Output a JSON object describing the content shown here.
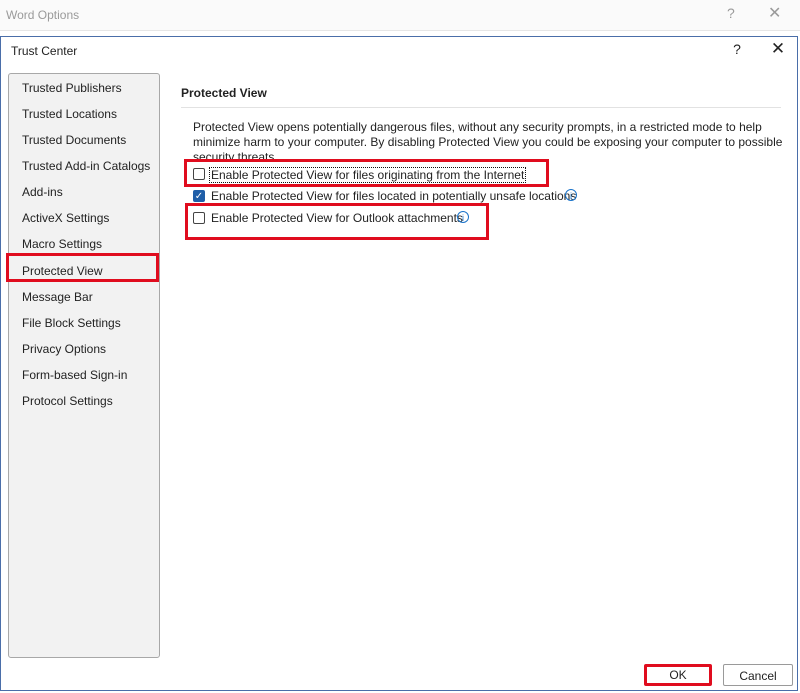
{
  "outer_window": {
    "title": "Word Options",
    "help": "?",
    "close": "✕"
  },
  "dialog": {
    "title": "Trust Center",
    "help": "?",
    "close": "✕"
  },
  "sidebar": {
    "items": [
      {
        "label": "Trusted Publishers"
      },
      {
        "label": "Trusted Locations"
      },
      {
        "label": "Trusted Documents"
      },
      {
        "label": "Trusted Add-in Catalogs"
      },
      {
        "label": "Add-ins"
      },
      {
        "label": "ActiveX Settings"
      },
      {
        "label": "Macro Settings"
      },
      {
        "label": "Protected View",
        "selected": true
      },
      {
        "label": "Message Bar"
      },
      {
        "label": "File Block Settings"
      },
      {
        "label": "Privacy Options"
      },
      {
        "label": "Form-based Sign-in"
      },
      {
        "label": "Protocol Settings"
      }
    ]
  },
  "main": {
    "section_title": "Protected View",
    "description": "Protected View opens potentially dangerous files, without any security prompts, in a restricted mode to help minimize harm to your computer. By disabling Protected View you could be exposing your computer to possible security threats.",
    "options": [
      {
        "label": "Enable Protected View for files originating from the Internet",
        "checked": false
      },
      {
        "label": "Enable Protected View for files located in potentially unsafe locations",
        "checked": true,
        "info_icon": "info-icon"
      },
      {
        "label": "Enable Protected View for Outlook attachments",
        "checked": false,
        "info_icon": "info-icon"
      }
    ]
  },
  "footer": {
    "ok_label": "OK",
    "cancel_label": "Cancel"
  },
  "colors": {
    "highlight": "#e00c1e",
    "checkbox_checked": "#1f5ea8",
    "info_icon": "#1a73c9",
    "dialog_border": "#4a6ea9"
  }
}
